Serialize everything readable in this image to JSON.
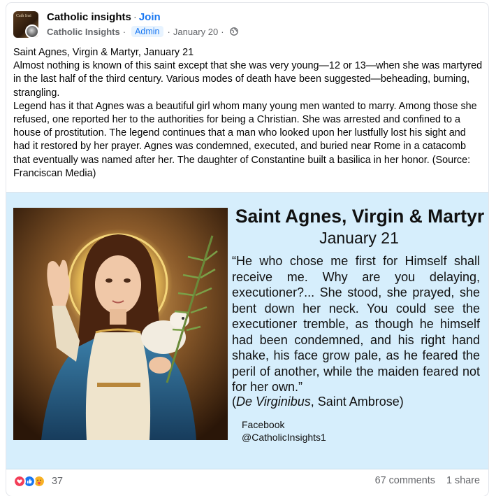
{
  "post": {
    "group_name": "Catholic insights",
    "join_label": "Join",
    "author": "Catholic Insights",
    "role_badge": "Admin",
    "date": "January 20",
    "audience_icon": "globe-icon",
    "avatar_text": "Cath Insi",
    "text_paragraphs": [
      "Saint Agnes, Virgin & Martyr, January 21",
      "Almost nothing is known of this saint except that she was very young—12 or 13—when she was martyred in the last half of the third century. Various modes of death have been suggested—beheading, burning, strangling.",
      "Legend has it that Agnes was a beautiful girl whom many young men wanted to marry. Among those she refused, one reported her to the authorities for being a Christian. She was arrested and confined to a house of prostitution. The legend continues that a man who looked upon her lustfully lost his sight and had it restored by her prayer. Agnes was condemned, executed, and buried near Rome in a catacomb that eventually was named after her. The daughter of Constantine built a basilica in her honor. (Source: Franciscan Media)"
    ]
  },
  "image": {
    "title": "Saint Agnes, Virgin & Martyr",
    "date": "January 21",
    "quote": "“He who chose me first for Himself shall receive me. Why are you delaying, executioner?... She stood, she prayed, she bent down her neck. You could see the executioner tremble, as though he himself had been condemned, and his right hand shake, his face grow pale, as he feared the peril of another, while the maiden feared not for her own.”",
    "source_open": "(",
    "source_work": "De Virginibus",
    "source_rest": ", Saint Ambrose)",
    "footer_line1": "Facebook",
    "footer_line2": "@CatholicInsights1",
    "background_color": "#d6eefc"
  },
  "stats": {
    "reaction_icons": [
      "love-icon",
      "like-icon",
      "care-icon"
    ],
    "reaction_count": "37",
    "comments": "67 comments",
    "shares": "1 share"
  },
  "colors": {
    "accent": "#1877f2",
    "secondary_text": "#65676b"
  }
}
